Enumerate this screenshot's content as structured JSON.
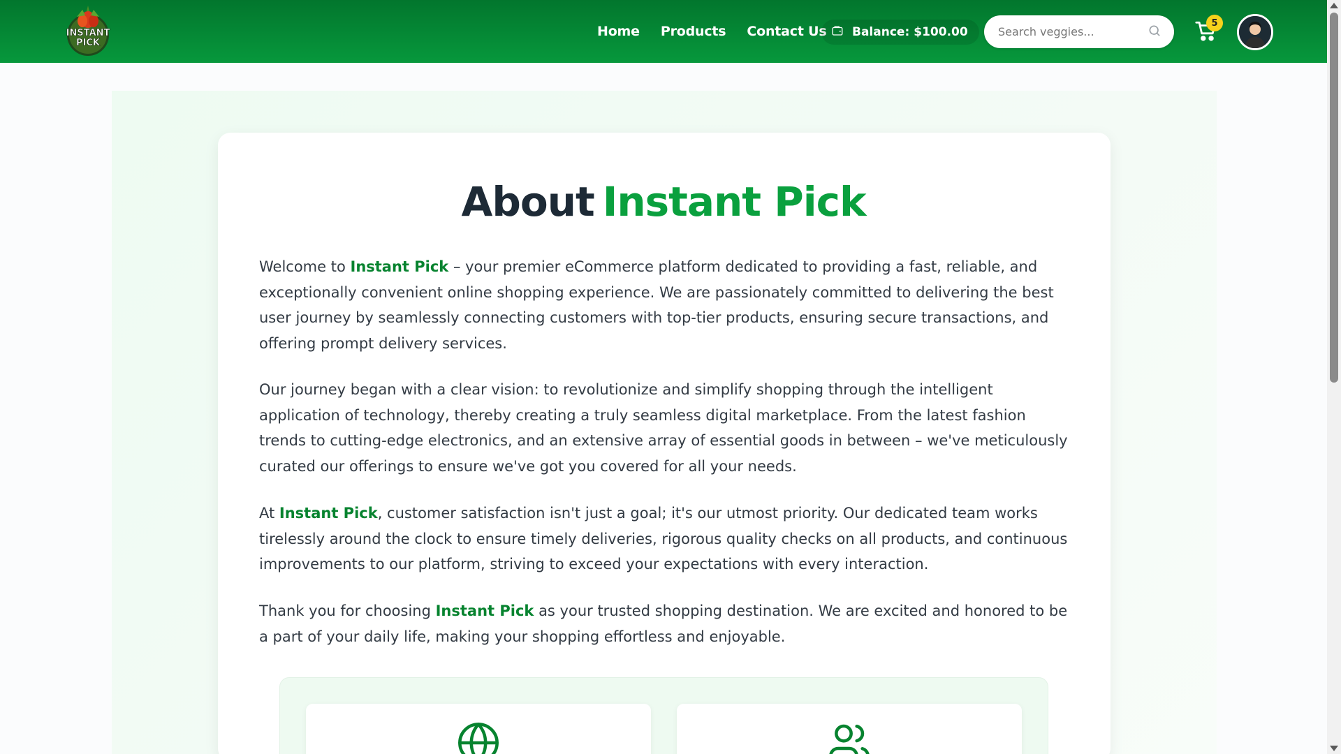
{
  "brand": {
    "logo_text_line1": "INSTANT",
    "logo_text_line2": "PICK",
    "accent_color": "#0aa03e",
    "header_color": "#048a34"
  },
  "nav": {
    "home": "Home",
    "products": "Products",
    "contact": "Contact Us"
  },
  "balance": {
    "label": "Balance:",
    "amount": "$100.00",
    "icon": "wallet-icon"
  },
  "search": {
    "placeholder": "Search veggies...",
    "icon": "search-icon"
  },
  "cart": {
    "count": "5",
    "icon": "cart-icon"
  },
  "about": {
    "title_part1": "About",
    "title_part2": "Instant Pick",
    "p1": {
      "before": "Welcome to ",
      "highlight": "Instant Pick",
      "after": " – your premier eCommerce platform dedicated to providing a fast, reliable, and exceptionally convenient online shopping experience. We are passionately committed to delivering the best user journey by seamlessly connecting customers with top-tier products, ensuring secure transactions, and offering prompt delivery services."
    },
    "p2": "Our journey began with a clear vision: to revolutionize and simplify shopping through the intelligent application of technology, thereby creating a truly seamless digital marketplace. From the latest fashion trends to cutting-edge electronics, and an extensive array of essential goods in between – we've meticulously curated our offerings to ensure we've got you covered for all your needs.",
    "p3": {
      "before": "At ",
      "highlight": "Instant Pick",
      "after": ", customer satisfaction isn't just a goal; it's our utmost priority. Our dedicated team works tirelessly around the clock to ensure timely deliveries, rigorous quality checks on all products, and continuous improvements to our platform, striving to exceed your expectations with every interaction."
    },
    "p4": {
      "before": "Thank you for choosing ",
      "highlight": "Instant Pick",
      "after": " as your trusted shopping destination. We are excited and honored to be a part of your daily life, making your shopping effortless and enjoyable."
    }
  },
  "features": [
    {
      "icon": "globe-icon"
    },
    {
      "icon": "users-icon"
    }
  ]
}
